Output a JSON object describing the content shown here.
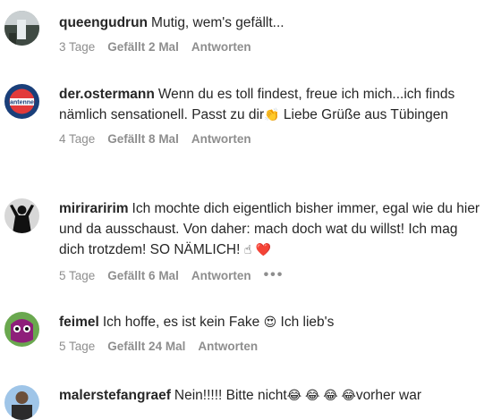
{
  "comments": [
    {
      "username": "queengudrun",
      "text": "Mutig, wem's gefällt...",
      "time": "3 Tage",
      "likes": "Gefällt 2 Mal",
      "reply": "Antworten",
      "avatar": "waterfall-photo-avatar"
    },
    {
      "username": "der.ostermann",
      "text_1": "Wenn du es toll findest, freue ich mich...ich finds nämlich sensationell. Passt zu dir",
      "emoji_1": "👏",
      "text_2": " Liebe Grüße aus Tübingen",
      "time": "4 Tage",
      "likes": "Gefällt 8 Mal",
      "reply": "Antworten",
      "avatar": "antenne-logo-avatar"
    },
    {
      "username": "miriraririm",
      "text_1": "Ich mochte dich eigentlich bisher immer, egal wie du hier und da ausschaust. Von daher: mach doch wat du willst! Ich mag dich trotzdem! SO NÄMLICH!",
      "emoji_1": "☝",
      "emoji_2": "❤️",
      "time": "5 Tage",
      "likes": "Gefällt 6 Mal",
      "reply": "Antworten",
      "more": "•••",
      "avatar": "silhouette-avatar"
    },
    {
      "username": "feimel",
      "text_1": "Ich hoffe, es ist kein Fake",
      "emoji_1": "😍",
      "text_2": " Ich lieb's",
      "time": "5 Tage",
      "likes": "Gefällt 24 Mal",
      "reply": "Antworten",
      "avatar": "purple-monster-avatar"
    },
    {
      "username": "malerstefangraef",
      "text_1": "Nein!!!!! Bitte nicht",
      "emoji_1": "😂 😂 😂 😂",
      "text_2": "vorher war",
      "avatar": "person-photo-avatar"
    }
  ]
}
